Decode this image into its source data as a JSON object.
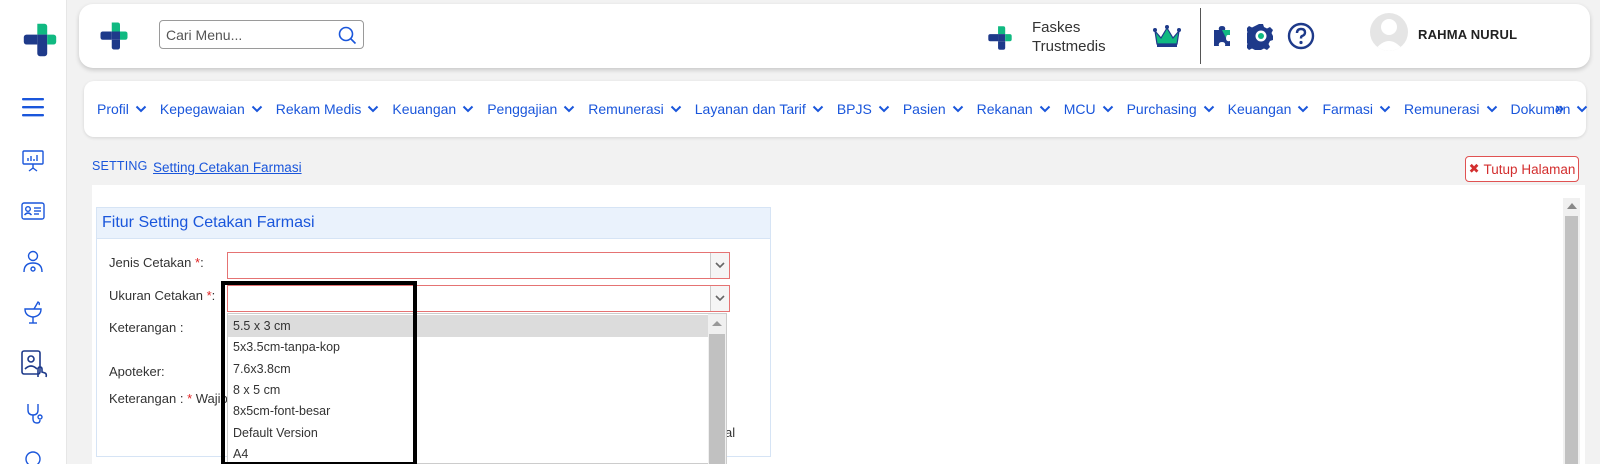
{
  "sidebar": {
    "items": [
      {
        "icon": "menu-icon"
      },
      {
        "icon": "presentation-icon"
      },
      {
        "icon": "id-card-icon"
      },
      {
        "icon": "patient-icon"
      },
      {
        "icon": "pharmacy-icon"
      },
      {
        "icon": "doctor-touch-icon"
      },
      {
        "icon": "stethoscope-icon"
      }
    ]
  },
  "header": {
    "search_placeholder": "Cari Menu...",
    "faskes_line1": "Faskes",
    "faskes_line2": "Trustmedis",
    "user_name": "RAHMA NURUL"
  },
  "nav": {
    "items": [
      "Profil",
      "Kepegawaian",
      "Rekam Medis",
      "Keuangan",
      "Penggajian",
      "Remunerasi",
      "Layanan dan Tarif",
      "BPJS",
      "Pasien",
      "Rekanan",
      "MCU",
      "Purchasing",
      "Keuangan",
      "Farmasi",
      "Remunerasi",
      "Dokumen"
    ],
    "more": "»"
  },
  "breadcrumb": {
    "root": "SETTING",
    "current": "Setting Cetakan Farmasi"
  },
  "close_button": {
    "icon": "✖",
    "label": "Tutup Halaman"
  },
  "panel": {
    "title": "Fitur Setting Cetakan Farmasi",
    "jenis_label": "Jenis Cetakan ",
    "ukuran_label": "Ukuran Cetakan ",
    "required_mark": "*",
    "colon": ":",
    "keterangan_label": "Keterangan :",
    "apoteker_label": "Apoteker:",
    "note_prefix": "Keterangan : ",
    "note_text": "Wajib",
    "note_tail": "al"
  },
  "dropdown": {
    "options": [
      "5.5 x 3 cm",
      "5x3.5cm-tanpa-kop",
      "7.6x3.8cm",
      "8 x 5 cm",
      "8x5cm-font-besar",
      "Default Version",
      "A4"
    ],
    "selected_index": 0
  },
  "colors": {
    "brand_blue": "#1a56db",
    "logo_blue": "#1e3a8a",
    "logo_green": "#10b981",
    "required_red": "#e02424"
  }
}
